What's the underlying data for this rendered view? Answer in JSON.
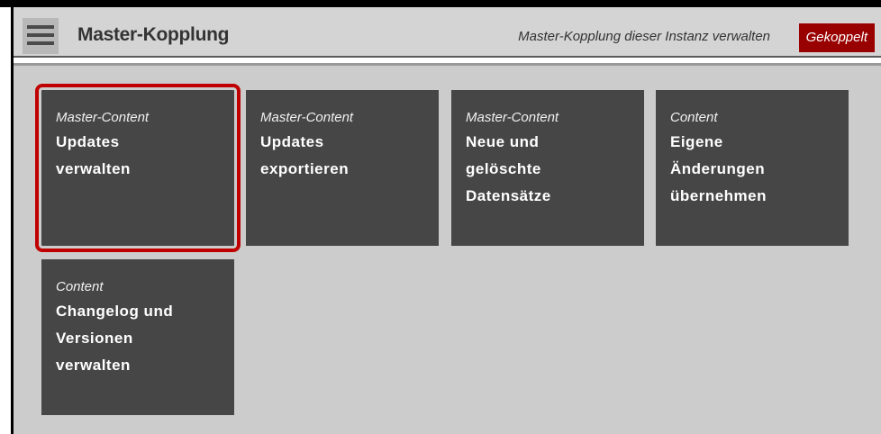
{
  "header": {
    "title": "Master-Kopplung",
    "subtitle": "Master-Kopplung dieser Instanz verwalten",
    "status_badge": "Gekoppelt",
    "menu_icon": "hamburger-icon"
  },
  "tiles": [
    {
      "category": "Master-Content",
      "title": "Updates\nverwalten",
      "selected": true
    },
    {
      "category": "Master-Content",
      "title": "Updates\nexportieren"
    },
    {
      "category": "Master-Content",
      "title": "Neue und\ngelöschte\nDatensätze"
    },
    {
      "category": "Content",
      "title": "Eigene\nÄnderungen\nübernehmen"
    },
    {
      "category": "Content",
      "title": "Changelog und\nVersionen\nverwalten"
    }
  ],
  "colors": {
    "header_bg": "#d4d4d4",
    "content_bg": "#cccccc",
    "tile_bg": "#464646",
    "badge_bg": "#990000",
    "selection": "#c00000"
  }
}
